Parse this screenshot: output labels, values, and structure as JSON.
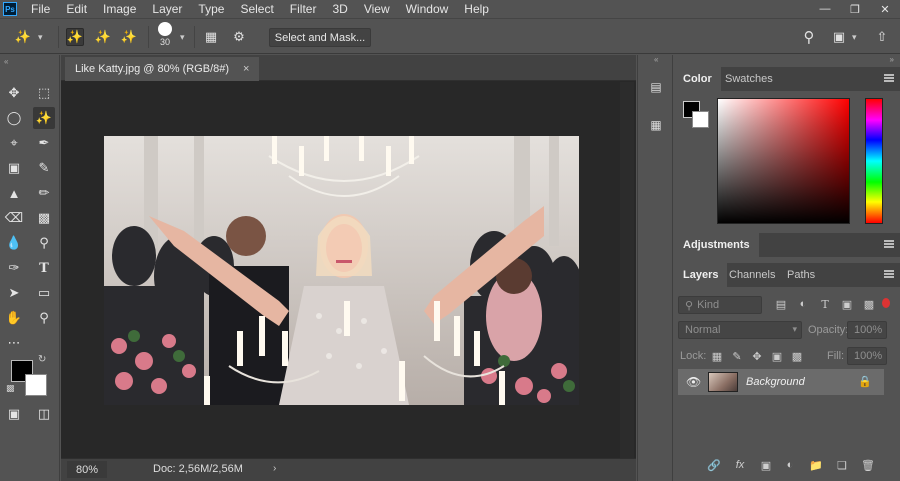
{
  "app": {
    "logo": "Ps",
    "menu": [
      "File",
      "Edit",
      "Image",
      "Layer",
      "Type",
      "Select",
      "Filter",
      "3D",
      "View",
      "Window",
      "Help"
    ]
  },
  "options": {
    "brush_size": "30",
    "select_mask_label": "Select and Mask..."
  },
  "document": {
    "tab_title": "Like Katty.jpg @ 80% (RGB/8#)",
    "zoom": "80%",
    "doc_size": "Doc: 2,56M/2,56M"
  },
  "color_panel": {
    "tabs": [
      "Color",
      "Swatches"
    ],
    "foreground": "#000000",
    "background": "#ffffff"
  },
  "adjustments_panel": {
    "title": "Adjustments"
  },
  "layers_panel": {
    "tabs": [
      "Layers",
      "Channels",
      "Paths"
    ],
    "kind_placeholder": "Kind",
    "blend_mode": "Normal",
    "opacity_label": "Opacity:",
    "opacity_value": "100%",
    "lock_label": "Lock:",
    "fill_label": "Fill:",
    "fill_value": "100%",
    "layers": [
      {
        "name": "Background",
        "visible": true,
        "locked": true
      }
    ]
  }
}
